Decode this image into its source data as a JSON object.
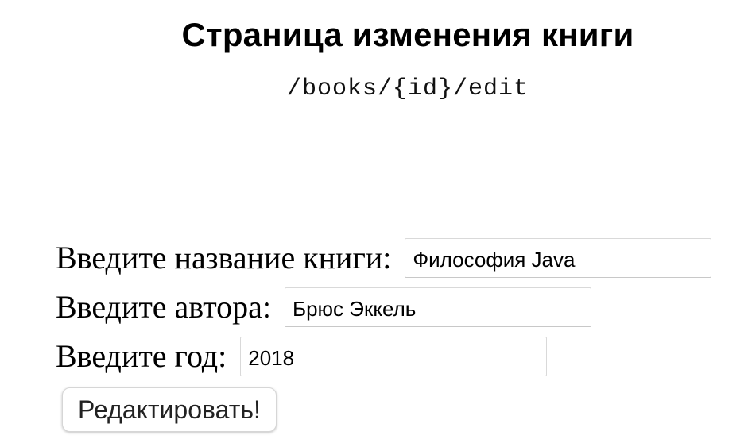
{
  "page": {
    "title": "Страница изменения книги",
    "route": "/books/{id}/edit"
  },
  "form": {
    "title_label": "Введите название книги:",
    "title_value": "Философия Java",
    "author_label": "Введите автора:",
    "author_value": "Брюс Эккель",
    "year_label": "Введите год:",
    "year_value": "2018",
    "submit_label": "Редактировать!"
  }
}
